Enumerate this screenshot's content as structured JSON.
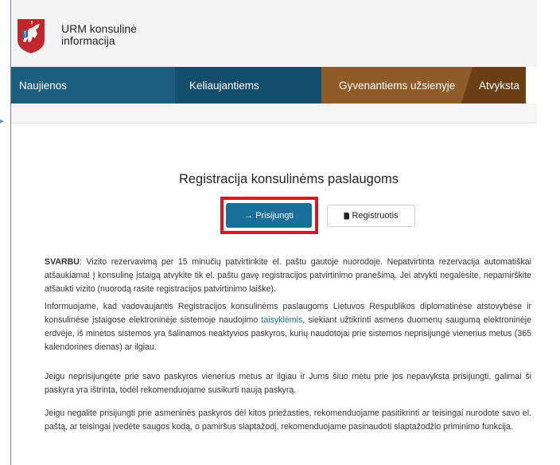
{
  "header": {
    "site_title_line1": "URM konsulinė",
    "site_title_line2": "informacija"
  },
  "nav": {
    "items": [
      "Naujienos",
      "Keliaujantiems",
      "Gyvenantiems užsienyje",
      "Atvyksta"
    ]
  },
  "main": {
    "heading": "Registracija konsulinėms paslaugoms",
    "login_button": "→ Prisijungti",
    "register_button": "Registruotis",
    "p1_bold": "SVARBU",
    "p1_rest": ": Vizito rezervavimą per 15 minučių patvirtinkite el. paštu gautoje nuorodoje. Nepatvirtinta rezervacija automatiškai atšaukiama! Į konsulinę įstaigą atvykite tik el. paštu gavę registracijos patvirtinimo pranešimą. Jei atvykti negalėsite, nepamirškite atšaukti vizito (nuorodą rasite registracijos patvirtinimo laiške).",
    "p2_before": "Informuojame, kad vadovaujantis Registracijos konsulinėms paslaugoms Lietuvos Respublikos diplomatinėse atstovybėse ir konsulinėse įstaigose elektroninėje sistemoje naudojimo ",
    "p2_link": "taisyklėmis",
    "p2_after": ", siekiant užtikrinti asmens duomenų saugumą elektroninėje erdvėje, iš minėtos sistemos yra šalinamos neaktyvios paskyros, kurių naudotojai prie sistemos neprisijungė vienerius metus (365 kalendorines dienas) ar ilgiau.",
    "p3": "Jeigu neprisijungėte prie savo paskyros vienerius metus ar ilgiau ir Jums šiuo metu prie jos nepavyksta prisijungti, galimai ši paskyra yra ištrinta, todėl rekomenduojame susikurti naują paskyrą.",
    "p4": "Jeigu negalite prisijungti prie asmeninės paskyros dėl kitos priežasties, rekomenduojame pasitikrinti ar teisingai nurodote savo el. paštą, ar teisingai įvedėte saugos kodą, o pamiršus slaptažodį, rekomenduojame pasinaudoti slaptažodžio priminimo funkcija."
  },
  "colors": {
    "nav_blue": "#1b5e80",
    "nav_brown": "#8f5b27",
    "login_button": "#1a6e9a",
    "highlight": "#e0141f"
  },
  "icons": [
    "lithuania-coat-of-arms-logo",
    "arrow-right-icon",
    "document-icon"
  ]
}
